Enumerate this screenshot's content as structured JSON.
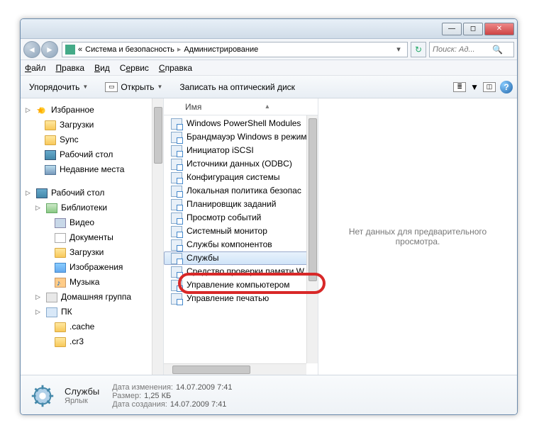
{
  "breadcrumb": {
    "prefix": "«",
    "part1": "Система и безопасность",
    "part2": "Администрирование"
  },
  "search": {
    "placeholder": "Поиск: Ад..."
  },
  "menu": {
    "file": "Файл",
    "edit": "Правка",
    "view": "Вид",
    "tools": "Сервис",
    "help": "Справка"
  },
  "toolbar": {
    "organize": "Упорядочить",
    "open": "Открыть",
    "burn": "Записать на оптический диск"
  },
  "sidebar": {
    "favorites": "Избранное",
    "fav_items": [
      "Загрузки",
      "Sync",
      "Рабочий стол",
      "Недавние места"
    ],
    "desktop": "Рабочий стол",
    "libraries": "Библиотеки",
    "lib_items": [
      "Видео",
      "Документы",
      "Загрузки",
      "Изображения",
      "Музыка"
    ],
    "homegroup": "Домашняя группа",
    "pc": "ПК",
    "pc_items": [
      ".cache",
      ".cr3"
    ]
  },
  "columns": {
    "name": "Имя"
  },
  "files": [
    "Windows PowerShell Modules",
    "Брандмауэр Windows в режим",
    "Инициатор iSCSI",
    "Источники данных (ODBC)",
    "Конфигурация системы",
    "Локальная политика безопас",
    "Планировщик заданий",
    "Просмотр событий",
    "Системный монитор",
    "Службы компонентов",
    "Службы",
    "Средство проверки памяти W",
    "Управление компьютером",
    "Управление печатью"
  ],
  "selected_index": 10,
  "preview_empty": "Нет данных для предварительного просмотра.",
  "details": {
    "name": "Службы",
    "type": "Ярлык",
    "date_mod_label": "Дата изменения:",
    "date_mod": "14.07.2009 7:41",
    "size_label": "Размер:",
    "size": "1,25 КБ",
    "date_created_label": "Дата создания:",
    "date_created": "14.07.2009 7:41"
  }
}
